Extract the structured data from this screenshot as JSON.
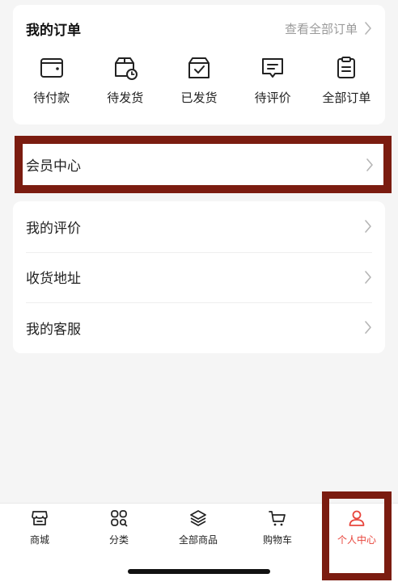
{
  "orders": {
    "title": "我的订单",
    "view_all": "查看全部订单",
    "items": [
      {
        "label": "待付款",
        "icon": "wallet-icon"
      },
      {
        "label": "待发货",
        "icon": "box-clock-icon"
      },
      {
        "label": "已发货",
        "icon": "box-check-icon"
      },
      {
        "label": "待评价",
        "icon": "comment-icon"
      },
      {
        "label": "全部订单",
        "icon": "clipboard-icon"
      }
    ]
  },
  "member": {
    "label": "会员中心"
  },
  "menu": {
    "items": [
      {
        "label": "我的评价"
      },
      {
        "label": "收货地址"
      },
      {
        "label": "我的客服"
      }
    ]
  },
  "tabbar": {
    "items": [
      {
        "label": "商城",
        "icon": "shop-icon"
      },
      {
        "label": "分类",
        "icon": "grid-search-icon"
      },
      {
        "label": "全部商品",
        "icon": "layers-icon"
      },
      {
        "label": "购物车",
        "icon": "cart-icon"
      },
      {
        "label": "个人中心",
        "icon": "user-icon"
      }
    ],
    "active_index": 4
  },
  "colors": {
    "accent": "#e8453c",
    "highlight_frame": "#7b1c10",
    "muted_text": "#9a9a9a"
  }
}
